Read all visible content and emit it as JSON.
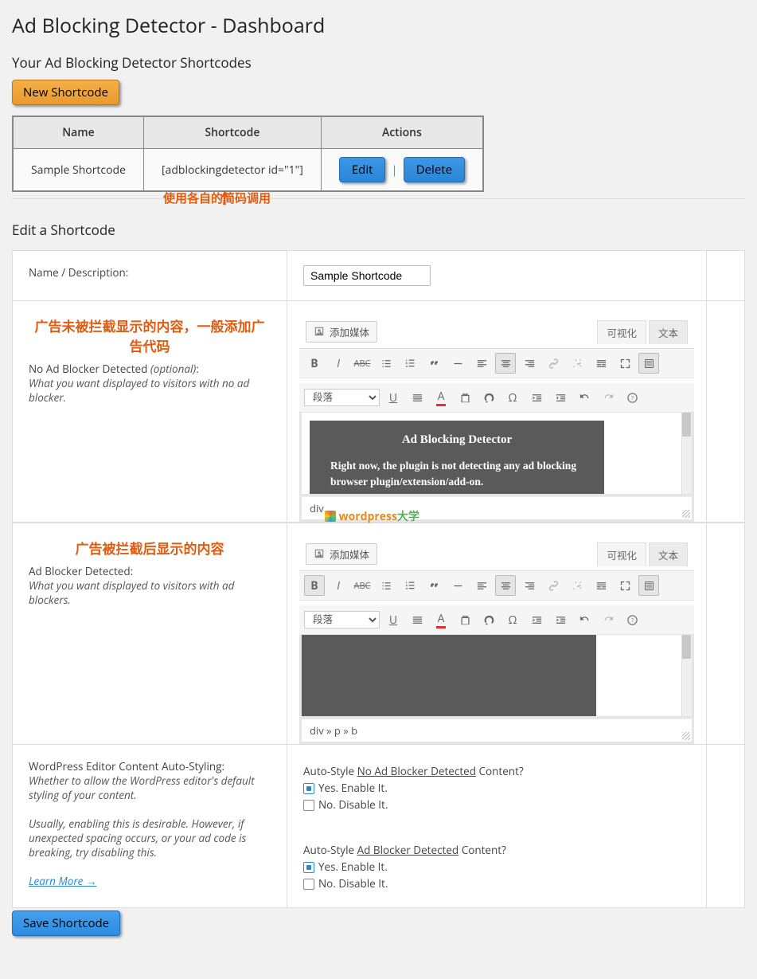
{
  "page_title": "Ad Blocking Detector - Dashboard",
  "section_shortcodes_title": "Your Ad Blocking Detector Shortcodes",
  "new_shortcode_btn": "New Shortcode",
  "table": {
    "headers": [
      "Name",
      "Shortcode",
      "Actions"
    ],
    "row": {
      "name": "Sample Shortcode",
      "shortcode": "[adblockingdetector id=\"1\"]",
      "edit": "Edit",
      "delete": "Delete"
    }
  },
  "callout_note": "使用各自的简码调用",
  "edit_section_title": "Edit a Shortcode",
  "form": {
    "name_label": "Name / Description:",
    "name_value": "Sample Shortcode",
    "no_blocker": {
      "red_note": "广告未被拦截显示的内容，一般添加广告代码",
      "label_a": "No Ad Blocker Detected ",
      "label_b": "(optional)",
      "label_c": ":",
      "help": "What you want displayed to visitors with no ad blocker."
    },
    "blocker": {
      "red_note": "广告被拦截后显示的内容",
      "label_a": "Ad Blocker Detected:",
      "help": "What you want displayed to visitors with ad blockers."
    },
    "autostyle": {
      "label_a": "WordPress Editor Content Auto-Styling:",
      "help": "Whether to allow the WordPress editor's default styling of your content.",
      "help2": "Usually, enabling this is desirable. However, if unexpected spacing occurs, or your ad code is breaking, try disabling this.",
      "learn": "Learn More →",
      "q1_a": "Auto-Style ",
      "q1_b": "No Ad Blocker Detected",
      "q1_c": " Content?",
      "q2_a": "Auto-Style ",
      "q2_b": "Ad Blocker Detected",
      "q2_c": " Content?",
      "yes": "Yes. Enable It.",
      "no": "No. Disable It."
    }
  },
  "editor": {
    "add_media": "添加媒体",
    "tab_visual": "可视化",
    "tab_text": "文本",
    "para_select": "段落",
    "preview_title": "Ad Blocking Detector",
    "preview_body": "Right now, the plugin is not detecting any ad blocking browser plugin/extension/add-on.",
    "path1": "div",
    "path2": "div » p » b"
  },
  "watermark": {
    "a": "wordpress",
    "b": "大学"
  },
  "save_btn": "Save Shortcode"
}
